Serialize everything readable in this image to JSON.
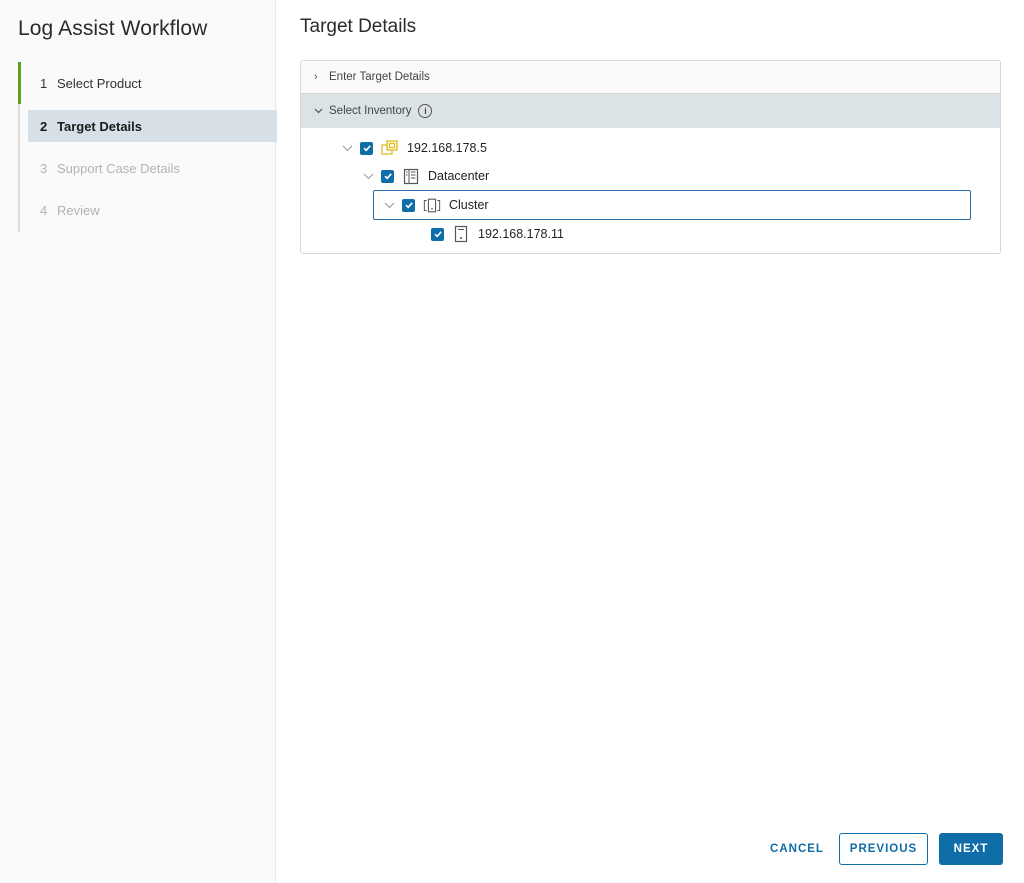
{
  "sidebar": {
    "title": "Log Assist Workflow",
    "steps": [
      {
        "num": "1",
        "label": "Select Product",
        "state": "completed"
      },
      {
        "num": "2",
        "label": "Target Details",
        "state": "active"
      },
      {
        "num": "3",
        "label": "Support Case Details",
        "state": "disabled"
      },
      {
        "num": "4",
        "label": "Review",
        "state": "disabled"
      }
    ]
  },
  "main": {
    "title": "Target Details",
    "accordion": {
      "enter_target": {
        "label": "Enter Target Details",
        "expanded": false
      },
      "select_inventory": {
        "label": "Select Inventory",
        "expanded": true
      }
    },
    "tree": [
      {
        "label": "192.168.178.5",
        "type": "vcenter",
        "icon": "vcenter-icon",
        "checked": true,
        "expanded": true
      },
      {
        "label": "Datacenter",
        "type": "datacenter",
        "icon": "datacenter-icon",
        "checked": true,
        "expanded": true
      },
      {
        "label": "Cluster",
        "type": "cluster",
        "icon": "cluster-icon",
        "checked": true,
        "expanded": true,
        "focused": true
      },
      {
        "label": "192.168.178.11",
        "type": "host",
        "icon": "host-icon",
        "checked": true
      }
    ]
  },
  "footer": {
    "cancel": "CANCEL",
    "previous": "PREVIOUS",
    "next": "NEXT"
  },
  "colors": {
    "accent": "#0f6ea8",
    "step_complete": "#5aa220",
    "active_step_bg": "#d6e0e6",
    "vcenter_icon": "#e8c23a"
  }
}
